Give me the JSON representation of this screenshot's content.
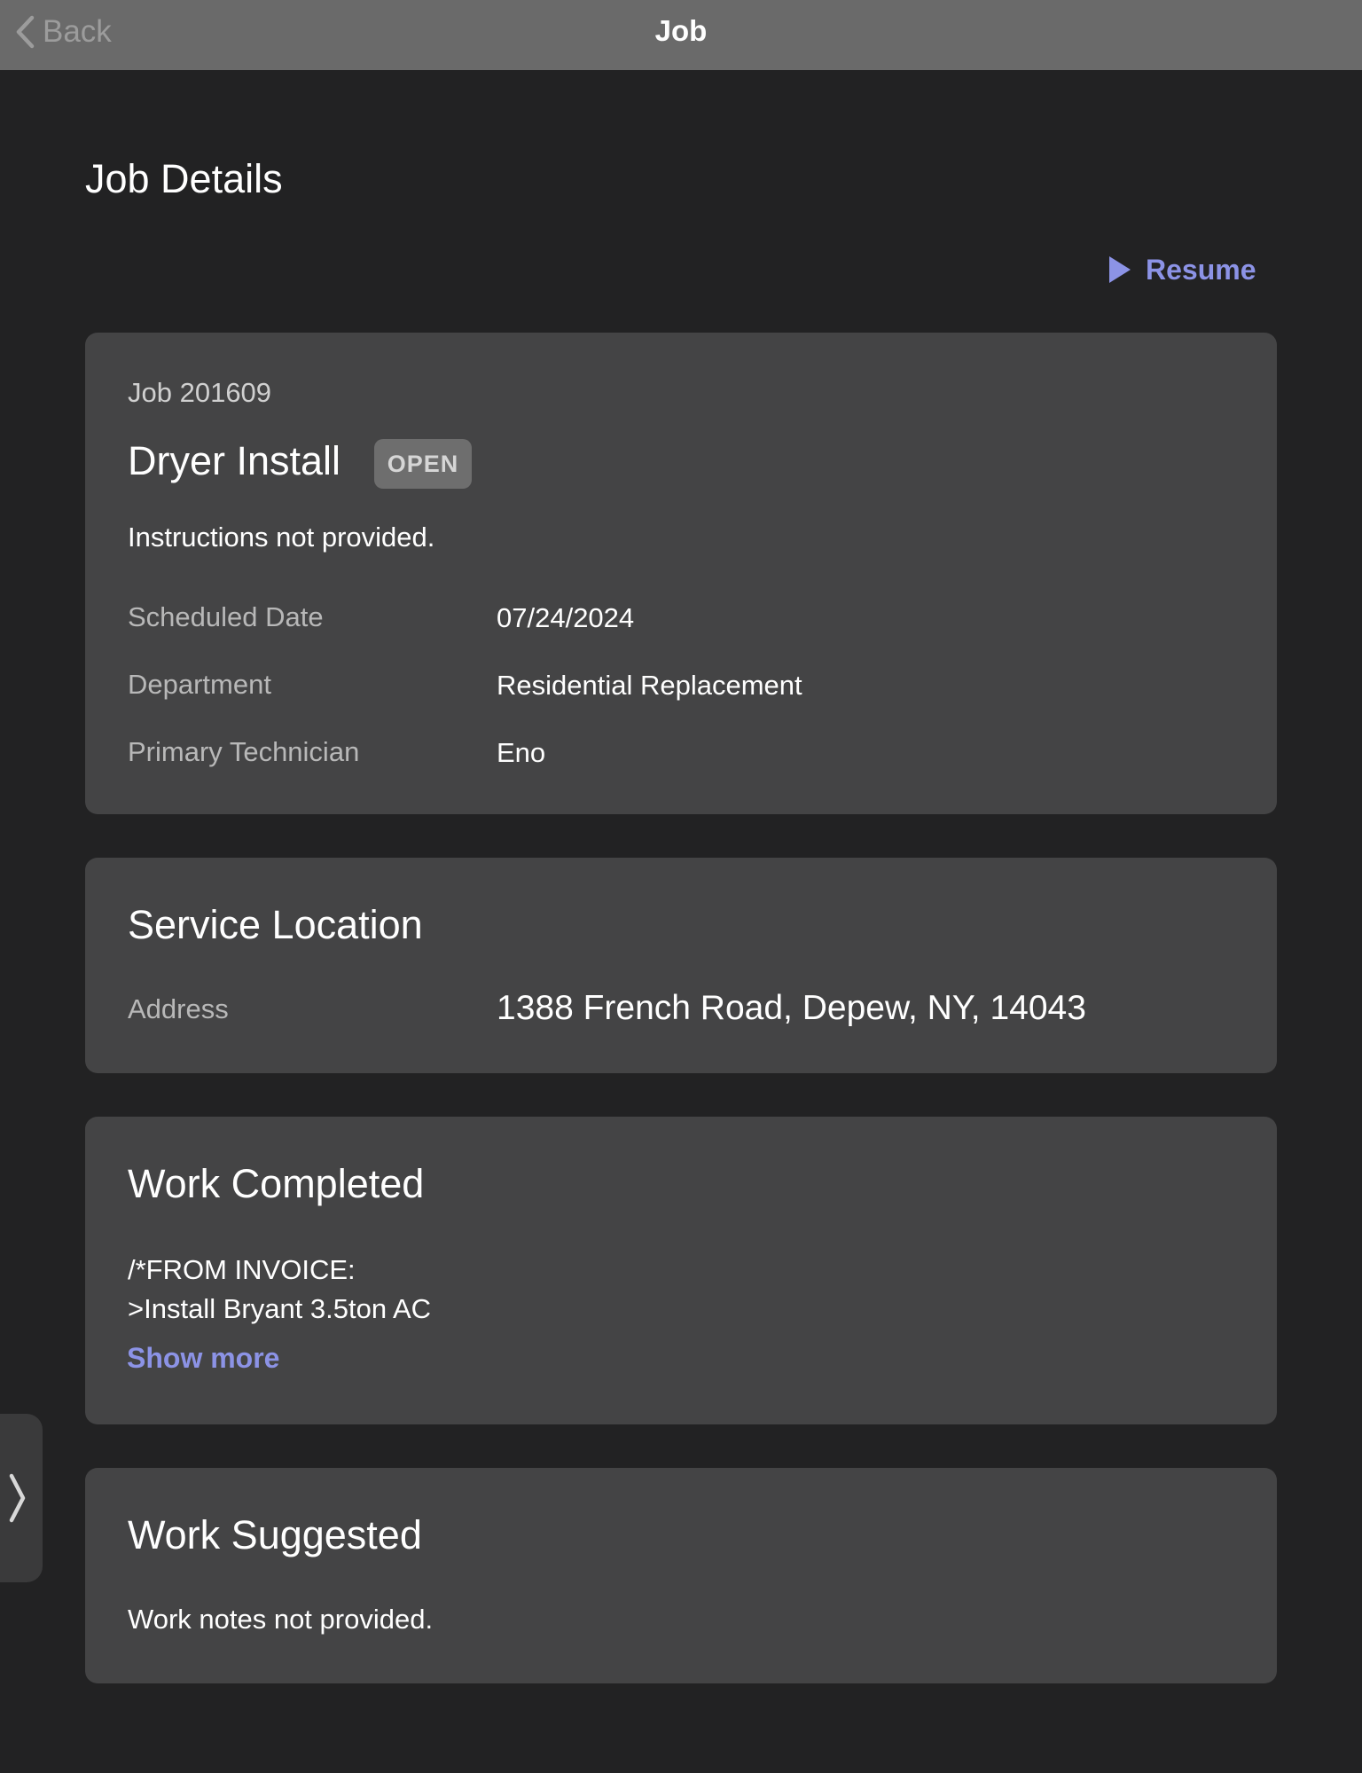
{
  "navbar": {
    "back_label": "Back",
    "title": "Job"
  },
  "page": {
    "title": "Job Details",
    "resume_label": "Resume"
  },
  "job": {
    "number": "Job 201609",
    "name": "Dryer Install",
    "status": "OPEN",
    "instructions": "Instructions not provided.",
    "fields": [
      {
        "label": "Scheduled Date",
        "value": "07/24/2024"
      },
      {
        "label": "Department",
        "value": "Residential Replacement"
      },
      {
        "label": "Primary Technician",
        "value": "Eno"
      }
    ]
  },
  "service_location": {
    "title": "Service Location",
    "address_label": "Address",
    "address_value": "1388 French Road, Depew, NY, 14043"
  },
  "work_completed": {
    "title": "Work Completed",
    "lines": [
      "/*FROM INVOICE:",
      ">Install Bryant 3.5ton AC"
    ],
    "show_more_label": "Show more"
  },
  "work_suggested": {
    "title": "Work Suggested",
    "notes": "Work notes not provided."
  },
  "colors": {
    "background": "#222223",
    "navbar": "#6a6a6a",
    "card": "#444445",
    "accent": "#8c93e6",
    "badge": "#6e6e6e"
  },
  "icons": {
    "back": "chevron-left-icon",
    "resume": "play-icon",
    "side_handle": "chevron-right-icon"
  }
}
